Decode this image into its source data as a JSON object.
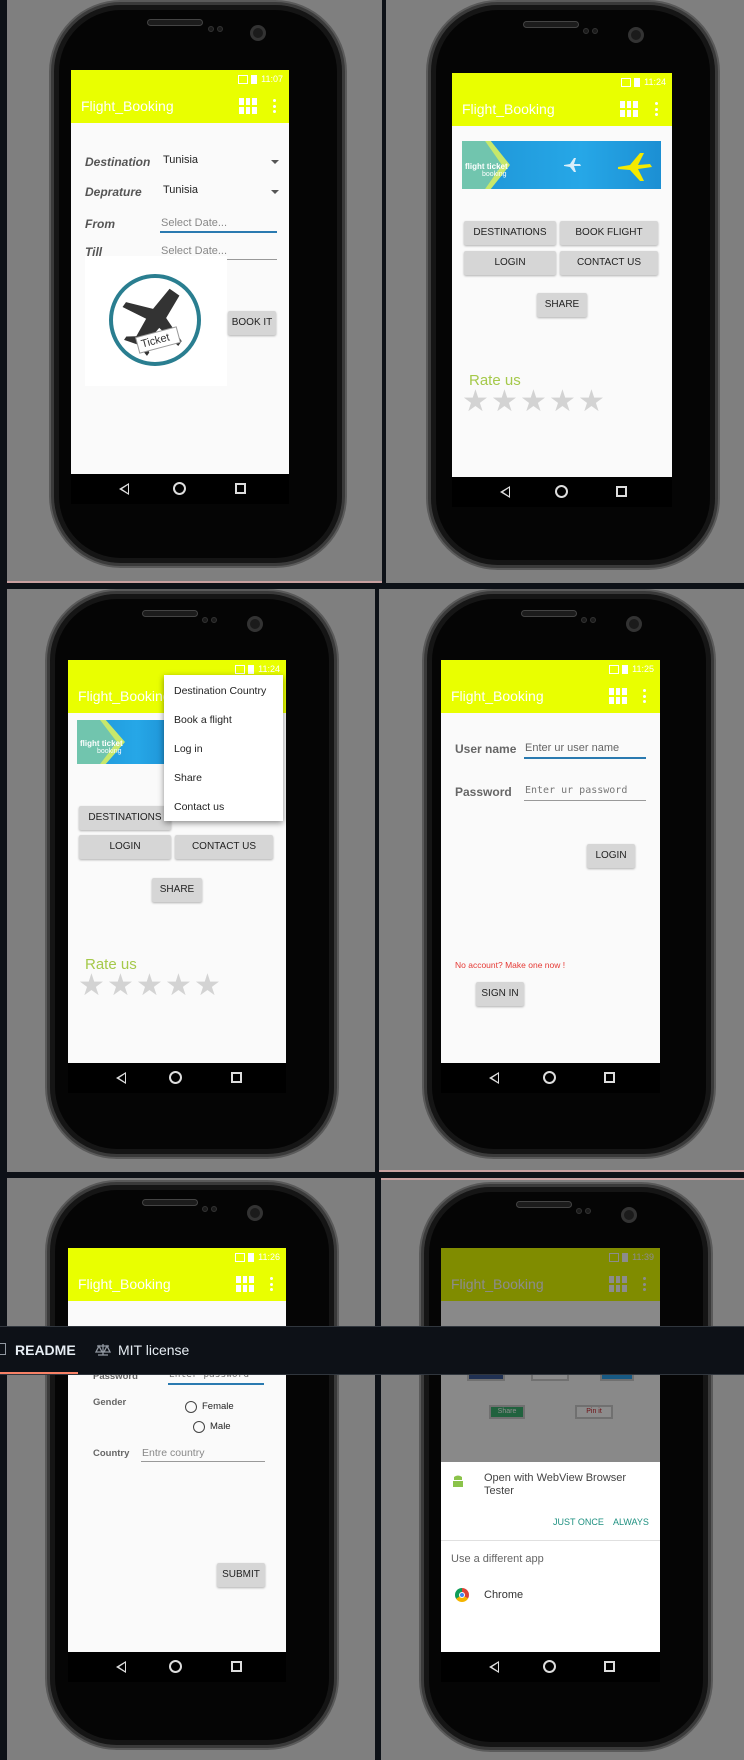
{
  "app_title": "Flight_Booking",
  "panel1": {
    "time": "11:07",
    "destination_label": "Destination",
    "destination_value": "Tunisia",
    "departure_label": "Deprature",
    "departure_value": "Tunisia",
    "from_label": "From",
    "from_placeholder": "Select Date...",
    "till_label": "Till",
    "till_placeholder": "Select Date...",
    "ticket_text": "Ticket",
    "book_it": "BOOK IT"
  },
  "panel2": {
    "time": "11:24",
    "banner_line1": "flight ticket",
    "banner_line2": "booking",
    "btn_destinations": "DESTINATIONS",
    "btn_book_flight": "BOOK FLIGHT",
    "btn_login": "LOGIN",
    "btn_contact": "CONTACT US",
    "btn_share": "SHARE",
    "rate_us": "Rate us",
    "rating": 0
  },
  "panel3": {
    "time": "11:24",
    "menu": [
      "Destination Country",
      "Book a flight",
      "Log in",
      "Share",
      "Contact us"
    ],
    "btn_destinations": "DESTINATIONS",
    "btn_login": "LOGIN",
    "btn_contact": "CONTACT US",
    "btn_share": "SHARE",
    "rate_us": "Rate us"
  },
  "panel4": {
    "time": "11:25",
    "username_label": "User name",
    "username_placeholder": "Enter ur user name",
    "password_label": "Password",
    "password_placeholder": "Enter ur password",
    "login_button": "LOGIN",
    "no_account": "No account? Make one now !",
    "signin_button": "SIGN IN"
  },
  "panel5": {
    "time": "11:26",
    "password_label": "Password",
    "password_placeholder": "Enter password",
    "gender_label": "Gender",
    "female": "Female",
    "male": "Male",
    "country_label": "Country",
    "country_placeholder": "Entre country",
    "submit": "SUBMIT"
  },
  "panel6": {
    "time": "11:39",
    "share_buttons": [
      "Share",
      "Share",
      "Tweet",
      "Share",
      "Pin it"
    ],
    "open_with": "Open with WebView Browser Tester",
    "just_once": "JUST ONCE",
    "always": "ALWAYS",
    "use_different": "Use a different app",
    "chrome": "Chrome"
  },
  "github_bar": {
    "readme": "README",
    "license": "MIT license"
  },
  "colors": {
    "appbar": "#e9ff00",
    "rate": "#a5c94a",
    "teal_action": "#1e9080",
    "error_red": "#e53935"
  }
}
